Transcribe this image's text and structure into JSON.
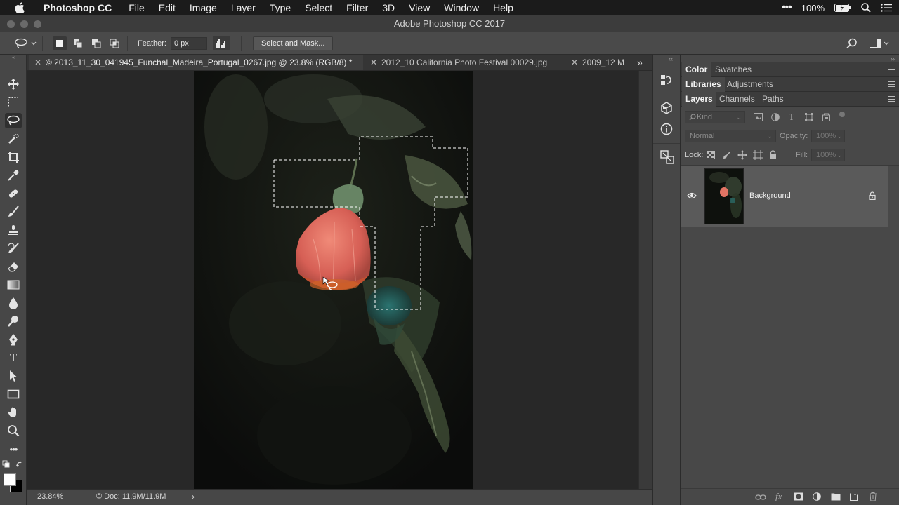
{
  "menubar": {
    "app_name": "Photoshop CC",
    "items": [
      "File",
      "Edit",
      "Image",
      "Layer",
      "Type",
      "Select",
      "Filter",
      "3D",
      "View",
      "Window",
      "Help"
    ],
    "battery": "100%"
  },
  "window": {
    "title": "Adobe Photoshop CC 2017"
  },
  "options": {
    "feather_label": "Feather:",
    "feather_value": "0 px",
    "select_mask_label": "Select and Mask..."
  },
  "tabs": [
    {
      "label": "© 2013_11_30_041945_Funchal_Madeira_Portugal_0267.jpg @ 23.8% (RGB/8) *"
    },
    {
      "label": "2012_10 California Photo Festival 00029.jpg"
    },
    {
      "label": "2009_12 M"
    }
  ],
  "status": {
    "zoom": "23.84%",
    "doc": "© Doc: 11.9M/11.9M"
  },
  "panels": {
    "group1": [
      "Color",
      "Swatches"
    ],
    "group2": [
      "Libraries",
      "Adjustments"
    ],
    "group3": [
      "Layers",
      "Channels",
      "Paths"
    ],
    "filter_kind": "Kind",
    "blend_mode": "Normal",
    "opacity_label": "Opacity:",
    "opacity_value": "100%",
    "lock_label": "Lock:",
    "fill_label": "Fill:",
    "fill_value": "100%",
    "layer_name": "Background"
  },
  "colors": {
    "accent_active": "#3e3e3e",
    "canvas": "#0f110f",
    "flower": "#e26b5f"
  }
}
